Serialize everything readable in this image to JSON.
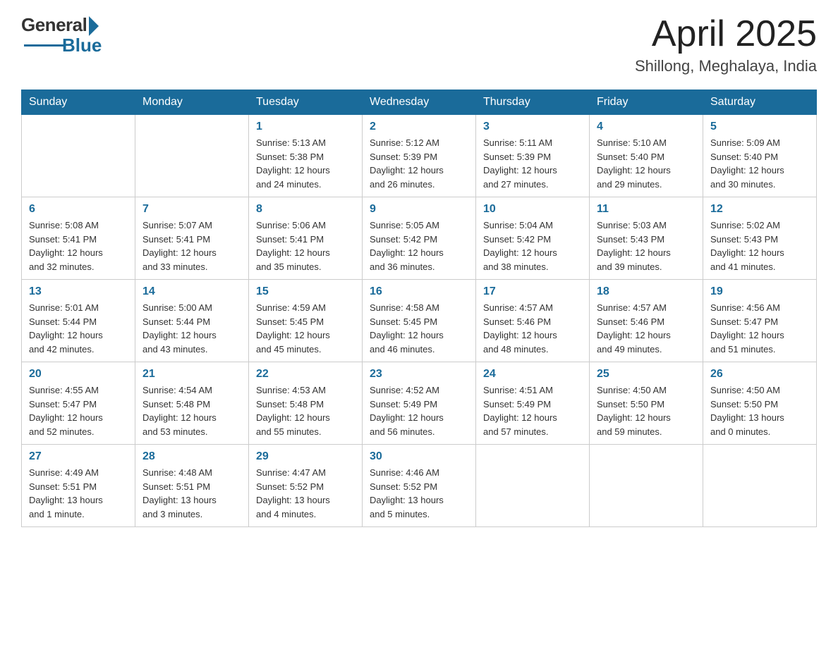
{
  "header": {
    "logo_general": "General",
    "logo_blue": "Blue",
    "month_year": "April 2025",
    "location": "Shillong, Meghalaya, India"
  },
  "days_of_week": [
    "Sunday",
    "Monday",
    "Tuesday",
    "Wednesday",
    "Thursday",
    "Friday",
    "Saturday"
  ],
  "weeks": [
    [
      {
        "day": "",
        "info": ""
      },
      {
        "day": "",
        "info": ""
      },
      {
        "day": "1",
        "info": "Sunrise: 5:13 AM\nSunset: 5:38 PM\nDaylight: 12 hours\nand 24 minutes."
      },
      {
        "day": "2",
        "info": "Sunrise: 5:12 AM\nSunset: 5:39 PM\nDaylight: 12 hours\nand 26 minutes."
      },
      {
        "day": "3",
        "info": "Sunrise: 5:11 AM\nSunset: 5:39 PM\nDaylight: 12 hours\nand 27 minutes."
      },
      {
        "day": "4",
        "info": "Sunrise: 5:10 AM\nSunset: 5:40 PM\nDaylight: 12 hours\nand 29 minutes."
      },
      {
        "day": "5",
        "info": "Sunrise: 5:09 AM\nSunset: 5:40 PM\nDaylight: 12 hours\nand 30 minutes."
      }
    ],
    [
      {
        "day": "6",
        "info": "Sunrise: 5:08 AM\nSunset: 5:41 PM\nDaylight: 12 hours\nand 32 minutes."
      },
      {
        "day": "7",
        "info": "Sunrise: 5:07 AM\nSunset: 5:41 PM\nDaylight: 12 hours\nand 33 minutes."
      },
      {
        "day": "8",
        "info": "Sunrise: 5:06 AM\nSunset: 5:41 PM\nDaylight: 12 hours\nand 35 minutes."
      },
      {
        "day": "9",
        "info": "Sunrise: 5:05 AM\nSunset: 5:42 PM\nDaylight: 12 hours\nand 36 minutes."
      },
      {
        "day": "10",
        "info": "Sunrise: 5:04 AM\nSunset: 5:42 PM\nDaylight: 12 hours\nand 38 minutes."
      },
      {
        "day": "11",
        "info": "Sunrise: 5:03 AM\nSunset: 5:43 PM\nDaylight: 12 hours\nand 39 minutes."
      },
      {
        "day": "12",
        "info": "Sunrise: 5:02 AM\nSunset: 5:43 PM\nDaylight: 12 hours\nand 41 minutes."
      }
    ],
    [
      {
        "day": "13",
        "info": "Sunrise: 5:01 AM\nSunset: 5:44 PM\nDaylight: 12 hours\nand 42 minutes."
      },
      {
        "day": "14",
        "info": "Sunrise: 5:00 AM\nSunset: 5:44 PM\nDaylight: 12 hours\nand 43 minutes."
      },
      {
        "day": "15",
        "info": "Sunrise: 4:59 AM\nSunset: 5:45 PM\nDaylight: 12 hours\nand 45 minutes."
      },
      {
        "day": "16",
        "info": "Sunrise: 4:58 AM\nSunset: 5:45 PM\nDaylight: 12 hours\nand 46 minutes."
      },
      {
        "day": "17",
        "info": "Sunrise: 4:57 AM\nSunset: 5:46 PM\nDaylight: 12 hours\nand 48 minutes."
      },
      {
        "day": "18",
        "info": "Sunrise: 4:57 AM\nSunset: 5:46 PM\nDaylight: 12 hours\nand 49 minutes."
      },
      {
        "day": "19",
        "info": "Sunrise: 4:56 AM\nSunset: 5:47 PM\nDaylight: 12 hours\nand 51 minutes."
      }
    ],
    [
      {
        "day": "20",
        "info": "Sunrise: 4:55 AM\nSunset: 5:47 PM\nDaylight: 12 hours\nand 52 minutes."
      },
      {
        "day": "21",
        "info": "Sunrise: 4:54 AM\nSunset: 5:48 PM\nDaylight: 12 hours\nand 53 minutes."
      },
      {
        "day": "22",
        "info": "Sunrise: 4:53 AM\nSunset: 5:48 PM\nDaylight: 12 hours\nand 55 minutes."
      },
      {
        "day": "23",
        "info": "Sunrise: 4:52 AM\nSunset: 5:49 PM\nDaylight: 12 hours\nand 56 minutes."
      },
      {
        "day": "24",
        "info": "Sunrise: 4:51 AM\nSunset: 5:49 PM\nDaylight: 12 hours\nand 57 minutes."
      },
      {
        "day": "25",
        "info": "Sunrise: 4:50 AM\nSunset: 5:50 PM\nDaylight: 12 hours\nand 59 minutes."
      },
      {
        "day": "26",
        "info": "Sunrise: 4:50 AM\nSunset: 5:50 PM\nDaylight: 13 hours\nand 0 minutes."
      }
    ],
    [
      {
        "day": "27",
        "info": "Sunrise: 4:49 AM\nSunset: 5:51 PM\nDaylight: 13 hours\nand 1 minute."
      },
      {
        "day": "28",
        "info": "Sunrise: 4:48 AM\nSunset: 5:51 PM\nDaylight: 13 hours\nand 3 minutes."
      },
      {
        "day": "29",
        "info": "Sunrise: 4:47 AM\nSunset: 5:52 PM\nDaylight: 13 hours\nand 4 minutes."
      },
      {
        "day": "30",
        "info": "Sunrise: 4:46 AM\nSunset: 5:52 PM\nDaylight: 13 hours\nand 5 minutes."
      },
      {
        "day": "",
        "info": ""
      },
      {
        "day": "",
        "info": ""
      },
      {
        "day": "",
        "info": ""
      }
    ]
  ]
}
